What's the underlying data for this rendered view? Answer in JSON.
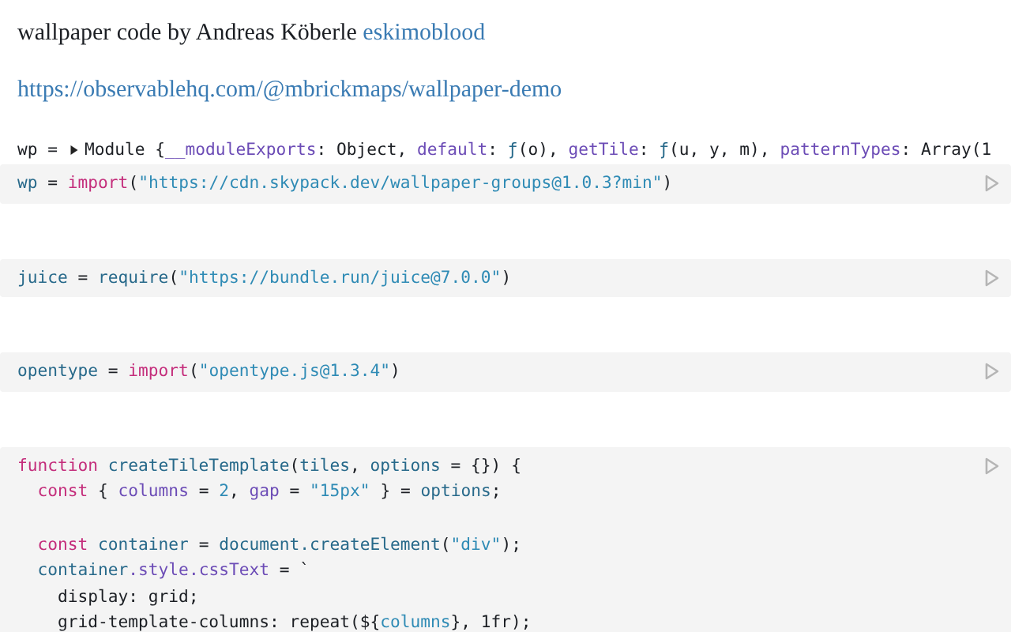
{
  "byline": {
    "text": "wallpaper code by Andreas Köberle",
    "link": "eskimoblood"
  },
  "source_link": "https://observablehq.com/@mbrickmaps/wallpaper-demo",
  "output": {
    "expanded": false,
    "name": "wp =",
    "tokens": [
      {
        "text": "Module {",
        "kind": "plain"
      },
      {
        "text": "__moduleExports",
        "kind": "prop"
      },
      {
        "text": ": Object, ",
        "kind": "plain"
      },
      {
        "text": "default",
        "kind": "prop"
      },
      {
        "text": ": ",
        "kind": "plain"
      },
      {
        "text": "ƒ",
        "kind": "def"
      },
      {
        "text": "(o), ",
        "kind": "plain"
      },
      {
        "text": "getTile",
        "kind": "prop"
      },
      {
        "text": ": ",
        "kind": "plain"
      },
      {
        "text": "ƒ",
        "kind": "def"
      },
      {
        "text": "(u, y, m), ",
        "kind": "plain"
      },
      {
        "text": "patternTypes",
        "kind": "prop"
      },
      {
        "text": ": Array(1",
        "kind": "plain"
      }
    ]
  },
  "cells": [
    {
      "lines": [
        {
          "kind": "code",
          "tokens": [
            {
              "text": "wp",
              "kind": "def"
            },
            {
              "text": " = ",
              "kind": "plain"
            },
            {
              "text": "import",
              "kind": "keyword"
            },
            {
              "text": "(",
              "kind": "plain"
            },
            {
              "text": "\"https://cdn.skypack.dev/wallpaper-groups@1.0.3?min\"",
              "kind": "string"
            },
            {
              "text": ")",
              "kind": "plain"
            }
          ]
        }
      ]
    },
    {
      "lines": [
        {
          "kind": "code",
          "tokens": [
            {
              "text": "juice",
              "kind": "def"
            },
            {
              "text": " = ",
              "kind": "plain"
            },
            {
              "text": "require",
              "kind": "def"
            },
            {
              "text": "(",
              "kind": "plain"
            },
            {
              "text": "\"https://bundle.run/juice@7.0.0\"",
              "kind": "string"
            },
            {
              "text": ")",
              "kind": "plain"
            }
          ]
        }
      ]
    },
    {
      "lines": [
        {
          "kind": "code",
          "tokens": [
            {
              "text": "opentype",
              "kind": "def"
            },
            {
              "text": " = ",
              "kind": "plain"
            },
            {
              "text": "import",
              "kind": "keyword"
            },
            {
              "text": "(",
              "kind": "plain"
            },
            {
              "text": "\"opentype.js@1.3.4\"",
              "kind": "string"
            },
            {
              "text": ")",
              "kind": "plain"
            }
          ]
        }
      ]
    },
    {
      "lines": [
        {
          "kind": "code",
          "tokens": [
            {
              "text": "function ",
              "kind": "keyword"
            },
            {
              "text": "createTileTemplate",
              "kind": "def"
            },
            {
              "text": "(",
              "kind": "plain"
            },
            {
              "text": "tiles",
              "kind": "def"
            },
            {
              "text": ", ",
              "kind": "plain"
            },
            {
              "text": "options",
              "kind": "def"
            },
            {
              "text": " = {}) {",
              "kind": "plain"
            }
          ]
        },
        {
          "kind": "code",
          "tokens": [
            {
              "text": "  const",
              "kind": "keyword"
            },
            {
              "text": " { ",
              "kind": "plain"
            },
            {
              "text": "columns",
              "kind": "prop"
            },
            {
              "text": " = ",
              "kind": "plain"
            },
            {
              "text": "2",
              "kind": "number"
            },
            {
              "text": ", ",
              "kind": "plain"
            },
            {
              "text": "gap",
              "kind": "prop"
            },
            {
              "text": " = ",
              "kind": "plain"
            },
            {
              "text": "\"15px\"",
              "kind": "string"
            },
            {
              "text": " } = ",
              "kind": "plain"
            },
            {
              "text": "options",
              "kind": "def"
            },
            {
              "text": ";",
              "kind": "plain"
            }
          ]
        },
        {
          "kind": "blank"
        },
        {
          "kind": "code",
          "tokens": [
            {
              "text": "  const ",
              "kind": "keyword"
            },
            {
              "text": "container",
              "kind": "def"
            },
            {
              "text": " = ",
              "kind": "plain"
            },
            {
              "text": "document",
              "kind": "def"
            },
            {
              "text": ".createElement",
              "kind": "def"
            },
            {
              "text": "(",
              "kind": "plain"
            },
            {
              "text": "\"div\"",
              "kind": "string"
            },
            {
              "text": ");",
              "kind": "plain"
            }
          ]
        },
        {
          "kind": "code",
          "tokens": [
            {
              "text": "  container",
              "kind": "def"
            },
            {
              "text": ".style",
              "kind": "prop"
            },
            {
              "text": ".cssText",
              "kind": "prop"
            },
            {
              "text": " = `",
              "kind": "plain"
            }
          ]
        },
        {
          "kind": "code",
          "tokens": [
            {
              "text": "    display: grid;",
              "kind": "plain"
            }
          ]
        },
        {
          "kind": "code",
          "tokens": [
            {
              "text": "    grid-template-columns: repeat(${",
              "kind": "plain"
            },
            {
              "text": "columns",
              "kind": "string"
            },
            {
              "text": "}, 1fr);",
              "kind": "plain"
            }
          ]
        }
      ]
    }
  ]
}
